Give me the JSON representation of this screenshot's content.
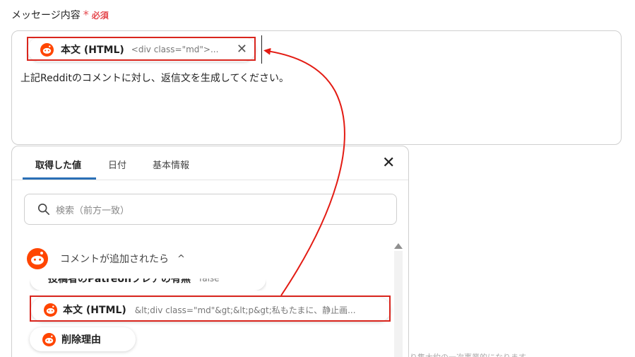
{
  "field": {
    "label": "メッセージ内容",
    "required_star": "*",
    "required_text": "必須"
  },
  "message_box": {
    "chip": {
      "title": "本文 (HTML)",
      "value": "<div class=\"md\">..."
    },
    "text": "上記Redditのコメントに対し、返信文を生成してください。"
  },
  "picker": {
    "tabs": [
      {
        "label": "取得した値",
        "active": true
      },
      {
        "label": "日付",
        "active": false
      },
      {
        "label": "基本情報",
        "active": false
      }
    ],
    "search": {
      "placeholder": "検索（前方一致）"
    },
    "group": {
      "title": "コメントが追加されたら",
      "chevron": "^"
    },
    "items": [
      {
        "title": "投稿者のPatreonフレアの有無",
        "value": "false"
      },
      {
        "title": "本文 (HTML)",
        "value": "&lt;div class=\"md\"&gt;&lt;p&gt;私もたまに、静止画..."
      },
      {
        "title": "削除理由",
        "value": ""
      }
    ]
  },
  "background_text": "り集大約の一次事業的になります",
  "colors": {
    "accent": "#2a6fb6",
    "required": "#e5484d",
    "highlight": "#d9251d",
    "reddit": "#ff4500"
  }
}
